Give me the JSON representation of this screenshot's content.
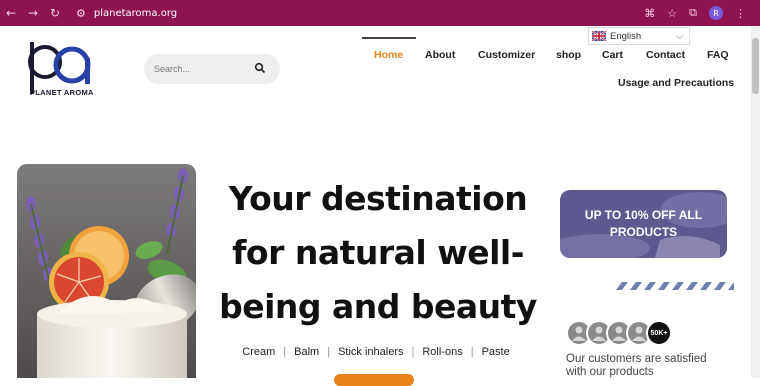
{
  "browser": {
    "url": "planetaroma.org",
    "profile_initial": "R"
  },
  "site": {
    "logo_text": "PLANET AROMA",
    "search": {
      "placeholder": "Search..."
    },
    "language": {
      "selected": "English"
    },
    "nav": [
      {
        "label": "Home",
        "active": true
      },
      {
        "label": "About"
      },
      {
        "label": "Customizer"
      },
      {
        "label": "shop"
      },
      {
        "label": "Cart"
      },
      {
        "label": "Contact"
      },
      {
        "label": "FAQ"
      },
      {
        "label": "Usage and Precautions"
      }
    ]
  },
  "hero": {
    "headline_lines": [
      "Your destination",
      "for natural well-",
      "being and beauty"
    ],
    "categories": [
      "Cream",
      "Balm",
      "Stick inhalers",
      "Roll-ons",
      "Paste"
    ]
  },
  "promo": {
    "text": "UP TO 10% OFF ALL PRODUCTS"
  },
  "social_proof": {
    "count_badge": "50K+",
    "text": "Our customers are satisfied with our products"
  },
  "colors": {
    "chrome": "#8e1450",
    "accent": "#e8841a",
    "promo_bg": "#5d5a90"
  }
}
